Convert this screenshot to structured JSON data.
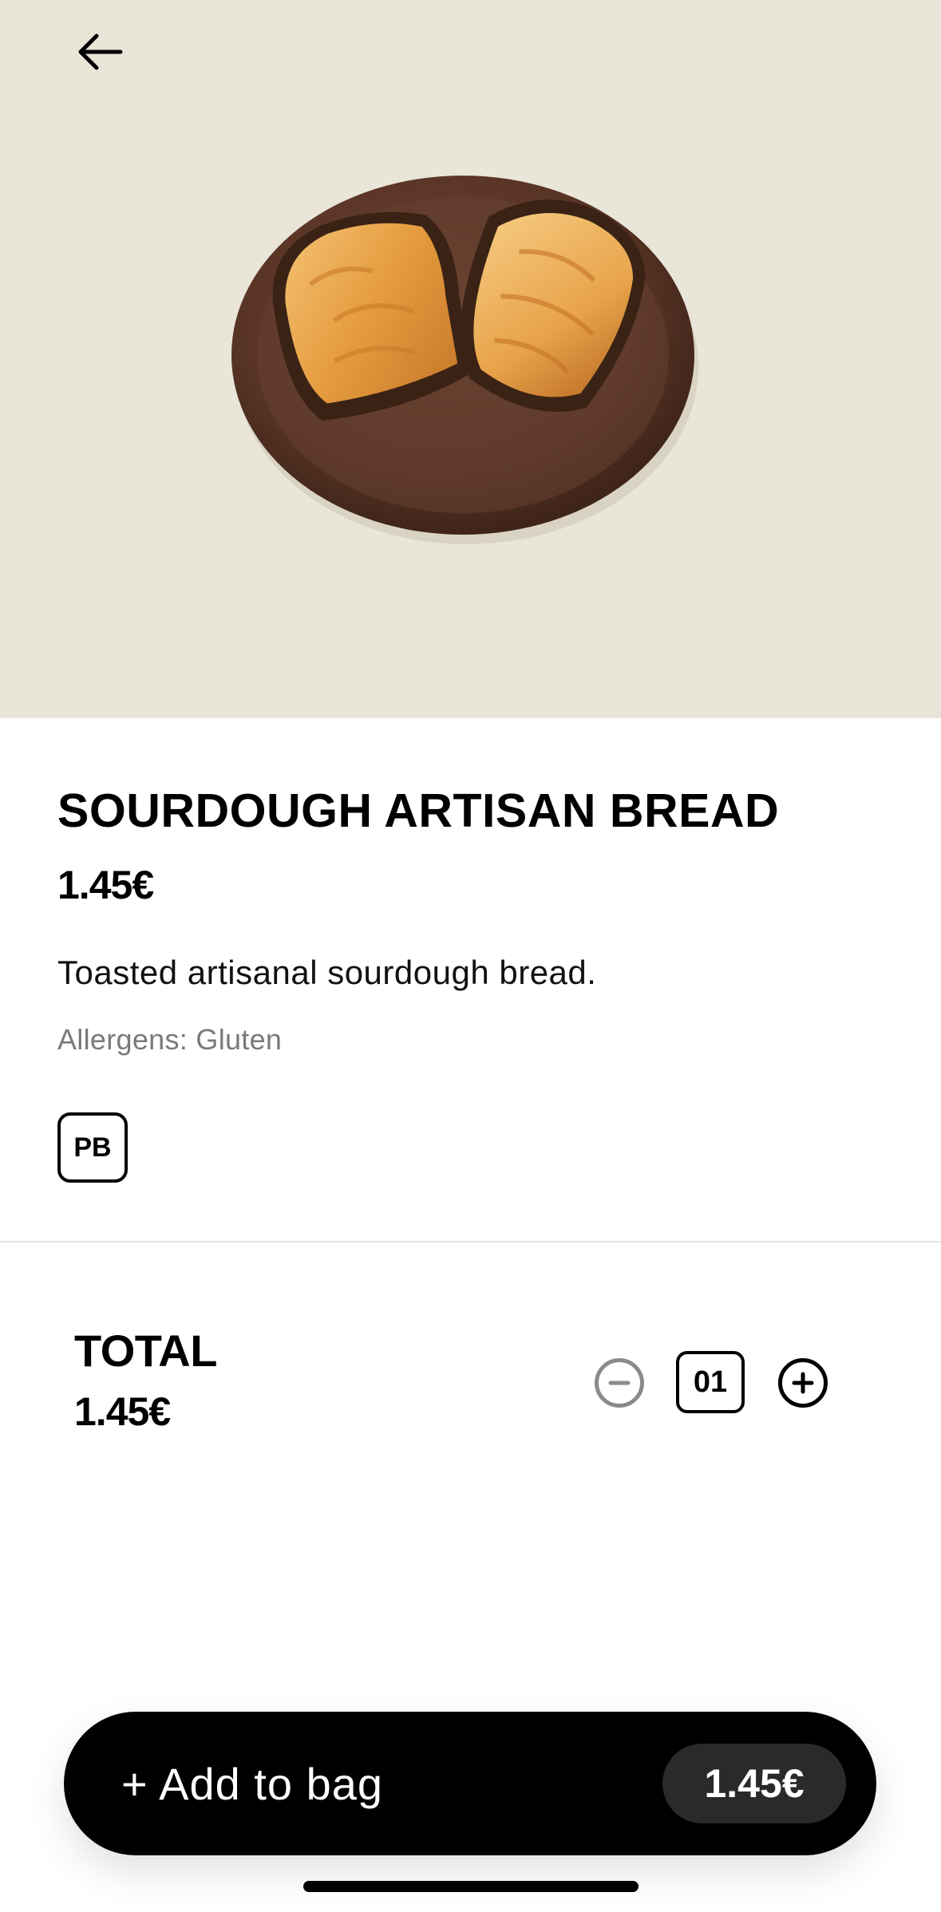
{
  "product": {
    "title": "SOURDOUGH ARTISAN BREAD",
    "price": "1.45€",
    "description": "Toasted artisanal sourdough bread.",
    "allergens": "Allergens: Gluten",
    "badge": "PB",
    "image": "toasted-sourdough-plate-image"
  },
  "header": {
    "back_icon": "arrow-left-icon"
  },
  "total": {
    "label": "TOTAL",
    "price": "1.45€"
  },
  "stepper": {
    "quantity": "01",
    "minus_icon": "minus-circle-icon",
    "plus_icon": "plus-circle-icon"
  },
  "cta": {
    "label": "+ Add to bag",
    "price": "1.45€"
  },
  "colors": {
    "hero_background": "#e9e5d8",
    "button_background": "#000000",
    "price_pill": "#2a2a2a",
    "muted_text": "#7a7a7a"
  }
}
